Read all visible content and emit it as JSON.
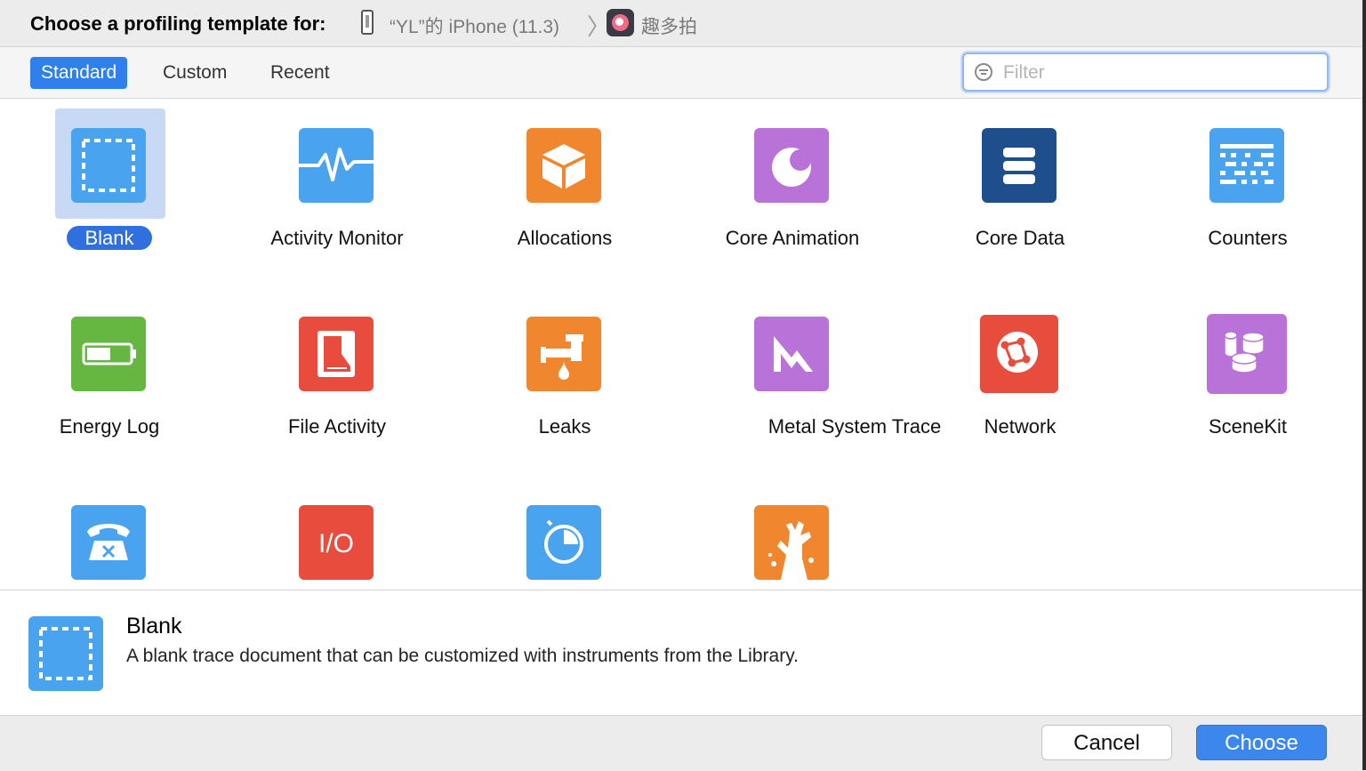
{
  "header": {
    "title": "Choose a profiling template for:",
    "device": "“YL”的 iPhone (11.3)",
    "separator": "〉",
    "app": "趣多拍"
  },
  "tabs": [
    {
      "label": "Standard",
      "active": true
    },
    {
      "label": "Custom",
      "active": false
    },
    {
      "label": "Recent",
      "active": false
    }
  ],
  "filter": {
    "placeholder": "Filter",
    "value": ""
  },
  "templates": [
    {
      "label": "Blank",
      "icon": "blank-template-icon",
      "color": "#4aa3ee",
      "selected": true
    },
    {
      "label": "Activity Monitor",
      "icon": "activity-monitor-icon",
      "color": "#4aa3ee"
    },
    {
      "label": "Allocations",
      "icon": "allocations-cube-icon",
      "color": "#f0872f"
    },
    {
      "label": "Core Animation",
      "icon": "core-animation-icon",
      "color": "#b872d8"
    },
    {
      "label": "Core Data",
      "icon": "core-data-icon",
      "color": "#1e4f8c"
    },
    {
      "label": "Counters",
      "icon": "counters-icon",
      "color": "#4aa3ee"
    },
    {
      "label": "Energy Log",
      "icon": "energy-log-battery-icon",
      "color": "#66b642"
    },
    {
      "label": "File Activity",
      "icon": "file-activity-icon",
      "color": "#e84c3d"
    },
    {
      "label": "Leaks",
      "icon": "leaks-faucet-icon",
      "color": "#f0872f"
    },
    {
      "label": "Metal System Trace",
      "icon": "metal-system-trace-icon",
      "color": "#b872d8"
    },
    {
      "label": "Network",
      "icon": "network-icon",
      "color": "#e84c3d"
    },
    {
      "label": "SceneKit",
      "icon": "scenekit-icon",
      "color": "#b872d8"
    },
    {
      "label": "",
      "icon": "system-usage-phone-icon",
      "color": "#4aa3ee"
    },
    {
      "label": "",
      "icon": "io-icon",
      "color": "#e84c3d"
    },
    {
      "label": "",
      "icon": "time-profiler-icon",
      "color": "#4aa3ee"
    },
    {
      "label": "",
      "icon": "zombies-icon",
      "color": "#f0872f"
    }
  ],
  "description": {
    "title": "Blank",
    "text": "A blank trace document that can be customized with instruments from the Library."
  },
  "buttons": {
    "cancel": "Cancel",
    "choose": "Choose"
  }
}
